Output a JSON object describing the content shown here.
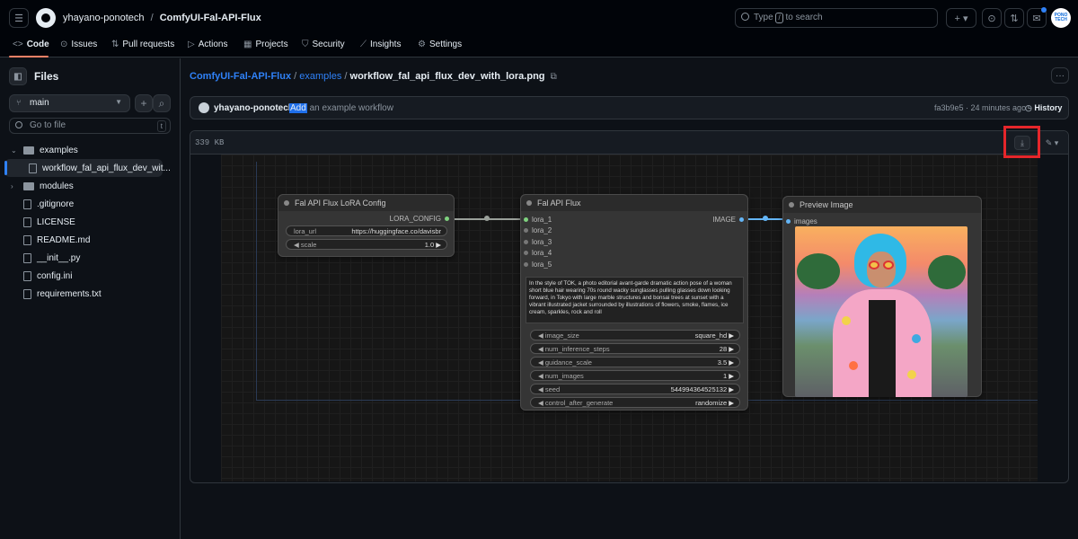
{
  "header": {
    "owner": "yhayano-ponotech",
    "separator": "/",
    "repo": "ComfyUI-Fal-API-Flux",
    "search_prefix": "Type",
    "search_key": "/",
    "search_suffix": "to search",
    "avatar_text": "PONO TECH"
  },
  "tabs": [
    {
      "label": "Code",
      "icon": "code-icon"
    },
    {
      "label": "Issues",
      "icon": "issue-icon"
    },
    {
      "label": "Pull requests",
      "icon": "pull-request-icon"
    },
    {
      "label": "Actions",
      "icon": "play-icon"
    },
    {
      "label": "Projects",
      "icon": "table-icon"
    },
    {
      "label": "Security",
      "icon": "shield-icon"
    },
    {
      "label": "Insights",
      "icon": "graph-icon"
    },
    {
      "label": "Settings",
      "icon": "gear-icon"
    }
  ],
  "sidebar": {
    "title": "Files",
    "branch": "main",
    "goto_placeholder": "Go to file",
    "goto_key": "t",
    "tree": [
      {
        "label": "examples",
        "type": "folder",
        "expanded": true
      },
      {
        "label": "workflow_fal_api_flux_dev_wit...",
        "type": "file",
        "selected": true
      },
      {
        "label": "modules",
        "type": "folder",
        "expanded": false
      },
      {
        "label": ".gitignore",
        "type": "file"
      },
      {
        "label": "LICENSE",
        "type": "file"
      },
      {
        "label": "README.md",
        "type": "file"
      },
      {
        "label": "__init__.py",
        "type": "file"
      },
      {
        "label": "config.ini",
        "type": "file"
      },
      {
        "label": "requirements.txt",
        "type": "file"
      }
    ]
  },
  "breadcrumb": {
    "repo": "ComfyUI-Fal-API-Flux",
    "folder": "examples",
    "file": "workflow_fal_api_flux_dev_with_lora.png",
    "sep": "/"
  },
  "commit": {
    "author": "yhayano-ponotech",
    "msg_highlight": "Add",
    "msg_rest": " an example workflow",
    "hash_time": "fa3b9e5 · 24 minutes ago",
    "history": "History"
  },
  "viewer": {
    "size": "339 KB"
  },
  "workflow": {
    "lora_node": {
      "title": "Fal API Flux LoRA Config",
      "output": "LORA_CONFIG",
      "widgets": [
        {
          "label": "lora_url",
          "value": "https://huggingface.co/davisbr"
        },
        {
          "label": "◀ scale",
          "value": "1.0 ▶"
        }
      ]
    },
    "flux_node": {
      "title": "Fal API Flux",
      "output": "IMAGE",
      "inputs": [
        "lora_1",
        "lora_2",
        "lora_3",
        "lora_4",
        "lora_5"
      ],
      "prompt": "In the style of TOK, a photo editorial avant-garde dramatic action pose of a woman short blue hair wearing 70s round wacky sunglasses pulling glasses down looking forward, in Tokyo with large marble structures and bonsai trees at sunset with a vibrant illustrated jacket surrounded by illustrations of flowers, smoke, flames, ice cream, sparkles, rock and roll",
      "widgets": [
        {
          "label": "◀ image_size",
          "value": "square_hd ▶"
        },
        {
          "label": "◀ num_inference_steps",
          "value": "28 ▶"
        },
        {
          "label": "◀ guidance_scale",
          "value": "3.5 ▶"
        },
        {
          "label": "◀ num_images",
          "value": "1 ▶"
        },
        {
          "label": "◀ seed",
          "value": "544994364525132 ▶"
        },
        {
          "label": "◀ control_after_generate",
          "value": "randomize ▶"
        }
      ]
    },
    "preview_node": {
      "title": "Preview Image",
      "input": "images"
    }
  },
  "colors": {
    "accent": "#2f81f7",
    "highlight_box": "#e5262b",
    "tab_underline": "#f78166"
  }
}
